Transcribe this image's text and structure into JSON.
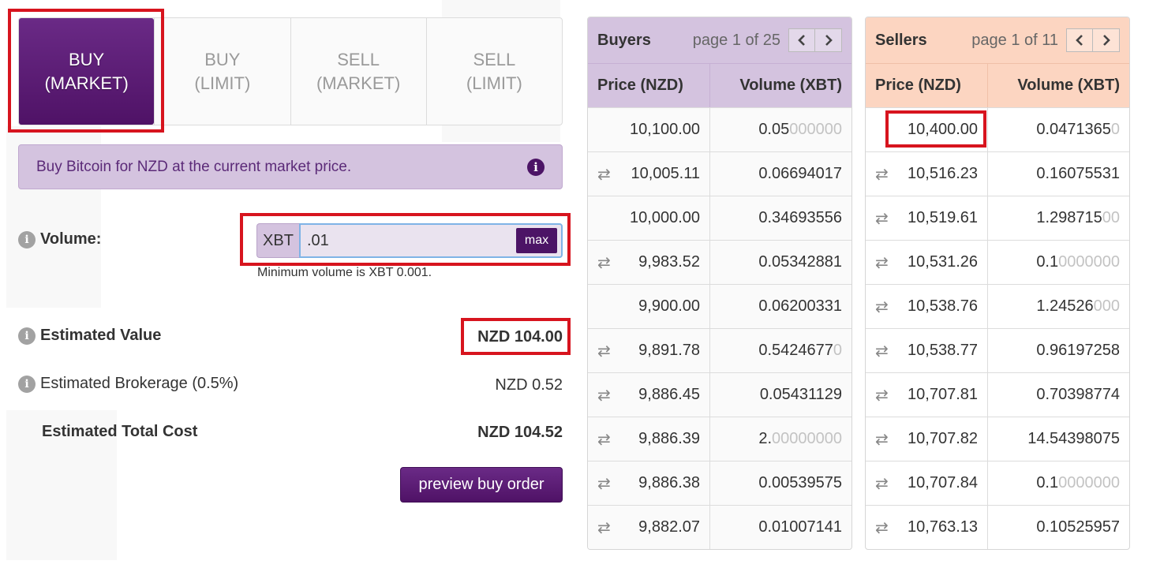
{
  "tabs": [
    {
      "line1": "BUY",
      "line2": "(MARKET)",
      "active": true
    },
    {
      "line1": "BUY",
      "line2": "(LIMIT)",
      "active": false
    },
    {
      "line1": "SELL",
      "line2": "(MARKET)",
      "active": false
    },
    {
      "line1": "SELL",
      "line2": "(LIMIT)",
      "active": false
    }
  ],
  "info_text": "Buy Bitcoin for NZD at the current market price.",
  "form": {
    "volume_label": "Volume:",
    "volume_prefix": "XBT",
    "volume_value": ".01",
    "max_label": "max",
    "volume_hint": "Minimum volume is XBT 0.001.",
    "estimated_value_label": "Estimated Value",
    "estimated_value": "NZD 104.00",
    "brokerage_label": "Estimated Brokerage (0.5%)",
    "brokerage_value": "NZD 0.52",
    "total_label": "Estimated Total Cost",
    "total_value": "NZD 104.52",
    "preview_label": "preview buy order"
  },
  "icons": {
    "info": "info-icon",
    "swap": "swap-arrows-icon",
    "prev": "chevron-left-icon",
    "next": "chevron-right-icon"
  },
  "buyers": {
    "title": "Buyers",
    "page": "page 1 of 25",
    "col_price": "Price (NZD)",
    "col_volume": "Volume (XBT)",
    "rows": [
      {
        "swap": false,
        "price": "10,100.00",
        "vol_main": "0.05",
        "vol_dim": "000000"
      },
      {
        "swap": true,
        "price": "10,005.11",
        "vol_main": "0.06694017",
        "vol_dim": ""
      },
      {
        "swap": false,
        "price": "10,000.00",
        "vol_main": "0.34693556",
        "vol_dim": ""
      },
      {
        "swap": true,
        "price": "9,983.52",
        "vol_main": "0.05342881",
        "vol_dim": ""
      },
      {
        "swap": false,
        "price": "9,900.00",
        "vol_main": "0.06200331",
        "vol_dim": ""
      },
      {
        "swap": true,
        "price": "9,891.78",
        "vol_main": "0.5424677",
        "vol_dim": "0"
      },
      {
        "swap": true,
        "price": "9,886.45",
        "vol_main": "0.05431129",
        "vol_dim": ""
      },
      {
        "swap": true,
        "price": "9,886.39",
        "vol_main": "2.",
        "vol_dim": "00000000"
      },
      {
        "swap": true,
        "price": "9,886.38",
        "vol_main": "0.00539575",
        "vol_dim": ""
      },
      {
        "swap": true,
        "price": "9,882.07",
        "vol_main": "0.01007141",
        "vol_dim": ""
      }
    ]
  },
  "sellers": {
    "title": "Sellers",
    "page": "page 1 of 11",
    "col_price": "Price (NZD)",
    "col_volume": "Volume (XBT)",
    "rows": [
      {
        "swap": false,
        "price": "10,400.00",
        "vol_main": "0.0471365",
        "vol_dim": "0"
      },
      {
        "swap": true,
        "price": "10,516.23",
        "vol_main": "0.16075531",
        "vol_dim": ""
      },
      {
        "swap": true,
        "price": "10,519.61",
        "vol_main": "1.298715",
        "vol_dim": "00"
      },
      {
        "swap": true,
        "price": "10,531.26",
        "vol_main": "0.1",
        "vol_dim": "0000000"
      },
      {
        "swap": true,
        "price": "10,538.76",
        "vol_main": "1.24526",
        "vol_dim": "000"
      },
      {
        "swap": true,
        "price": "10,538.77",
        "vol_main": "0.96197258",
        "vol_dim": ""
      },
      {
        "swap": true,
        "price": "10,707.81",
        "vol_main": "0.70398774",
        "vol_dim": ""
      },
      {
        "swap": true,
        "price": "10,707.82",
        "vol_main": "14.54398075",
        "vol_dim": ""
      },
      {
        "swap": true,
        "price": "10,707.84",
        "vol_main": "0.1",
        "vol_dim": "0000000"
      },
      {
        "swap": true,
        "price": "10,763.13",
        "vol_main": "0.10525957",
        "vol_dim": ""
      }
    ]
  }
}
